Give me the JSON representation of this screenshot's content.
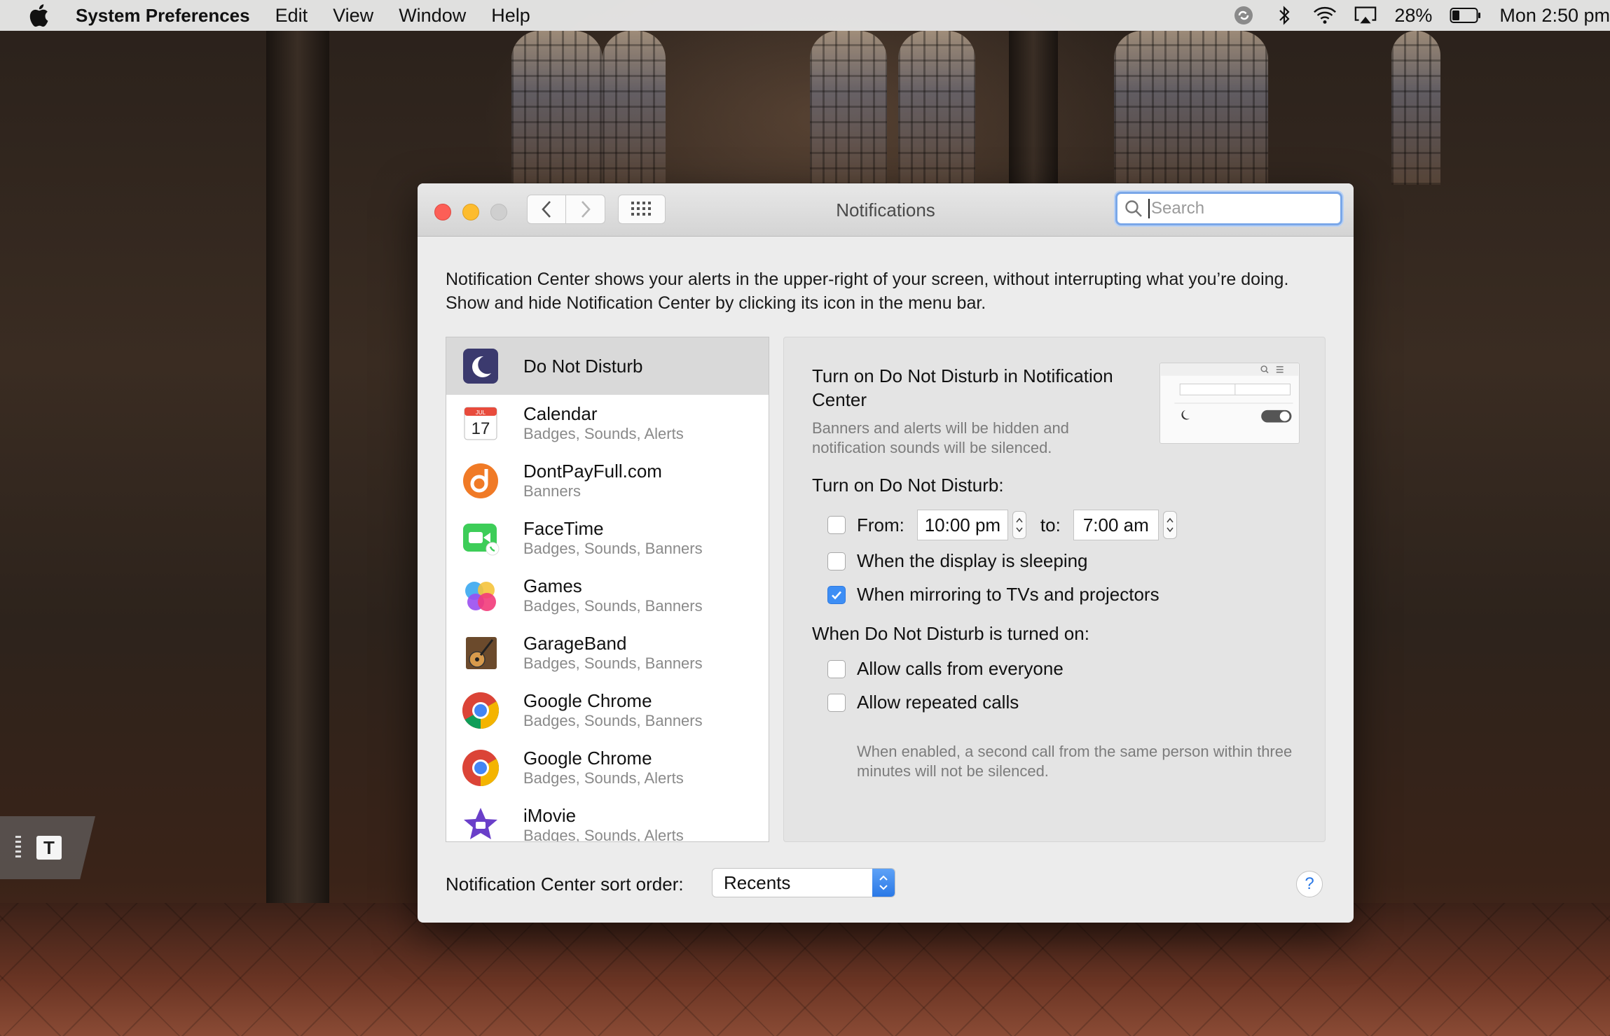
{
  "menubar": {
    "app_name": "System Preferences",
    "menus": [
      "Edit",
      "View",
      "Window",
      "Help"
    ],
    "battery": "28%",
    "clock": "Mon 2:50 pm",
    "icons": [
      "apple-icon",
      "creative-cloud-icon",
      "bluetooth-icon",
      "wifi-icon",
      "airplay-icon",
      "battery-icon"
    ]
  },
  "widget": {
    "letter": "T"
  },
  "window": {
    "title": "Notifications",
    "search_placeholder": "Search",
    "intro": "Notification Center shows your alerts in the upper-right of your screen, without interrupting what you’re doing. Show and hide Notification Center by clicking its icon in the menu bar."
  },
  "apps": [
    {
      "name": "Do Not Disturb",
      "sub": "",
      "icon": "moon-icon"
    },
    {
      "name": "Calendar",
      "sub": "Badges, Sounds, Alerts",
      "icon": "calendar-icon",
      "icon_text": "17",
      "icon_month": "JUL"
    },
    {
      "name": "DontPayFull.com",
      "sub": "Banners",
      "icon": "dontpayfull-icon"
    },
    {
      "name": "FaceTime",
      "sub": "Badges, Sounds, Banners",
      "icon": "facetime-icon"
    },
    {
      "name": "Games",
      "sub": "Badges, Sounds, Banners",
      "icon": "game-center-icon"
    },
    {
      "name": "GarageBand",
      "sub": "Badges, Sounds, Banners",
      "icon": "garageband-icon"
    },
    {
      "name": "Google Chrome",
      "sub": "Badges, Sounds, Banners",
      "icon": "chrome-icon"
    },
    {
      "name": "Google Chrome",
      "sub": "Badges, Sounds, Alerts",
      "icon": "chrome-icon"
    },
    {
      "name": "iMovie",
      "sub": "Badges, Sounds, Alerts",
      "icon": "imovie-icon"
    }
  ],
  "detail": {
    "title": "Turn on Do Not Disturb in Notification Center",
    "description": "Banners and alerts will be hidden and notification sounds will be silenced.",
    "schedule_heading": "Turn on Do Not Disturb:",
    "from_label": "From:",
    "from_time": "10:00 pm",
    "to_label": "to:",
    "to_time": "7:00 am",
    "sleeping_label": "When the display is sleeping",
    "mirroring_label": "When mirroring to TVs and projectors",
    "when_on_heading": "When Do Not Disturb is turned on:",
    "calls_label": "Allow calls from everyone",
    "repeated_label": "Allow repeated calls",
    "note": "When enabled, a second call from the same person within three minutes will not be silenced.",
    "checks": {
      "from": false,
      "sleeping": false,
      "mirroring": true,
      "calls": false,
      "repeated": false
    }
  },
  "footer": {
    "sort_label": "Notification Center sort order:",
    "sort_value": "Recents",
    "help": "?"
  },
  "colors": {
    "accent": "#3d8ef5",
    "close": "#fc5f57",
    "minimize": "#fdbc2e"
  }
}
